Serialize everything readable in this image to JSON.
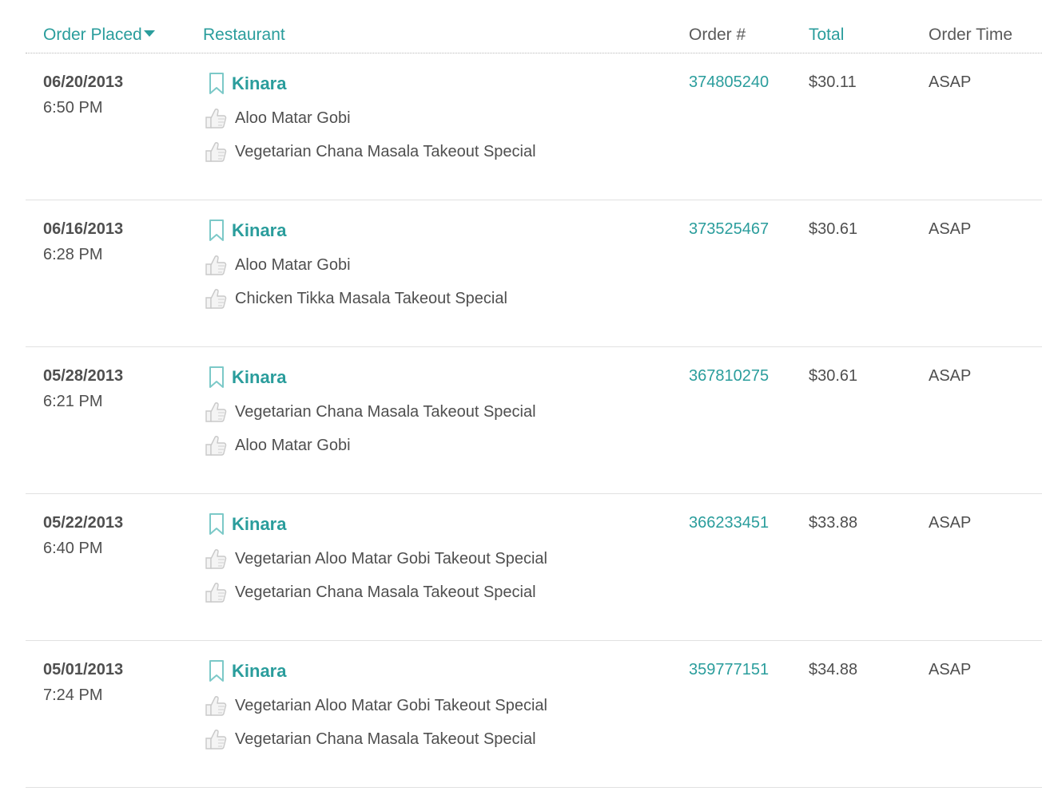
{
  "columns": {
    "order_placed": "Order Placed",
    "restaurant": "Restaurant",
    "order_number": "Order #",
    "total": "Total",
    "order_time": "Order Time"
  },
  "colors": {
    "accent": "#2a9d9c",
    "text": "#4f4f4f"
  },
  "icons": {
    "bookmark": "bookmark-icon",
    "item": "thumbs-up-icon",
    "sort": "sort-descending-arrow"
  },
  "orders": [
    {
      "date": "06/20/2013",
      "time": "6:50 PM",
      "restaurant": "Kinara",
      "items": [
        "Aloo Matar Gobi",
        "Vegetarian Chana Masala Takeout Special"
      ],
      "order_number": "374805240",
      "total": "$30.11",
      "order_time": "ASAP"
    },
    {
      "date": "06/16/2013",
      "time": "6:28 PM",
      "restaurant": "Kinara",
      "items": [
        "Aloo Matar Gobi",
        "Chicken Tikka Masala Takeout Special"
      ],
      "order_number": "373525467",
      "total": "$30.61",
      "order_time": "ASAP"
    },
    {
      "date": "05/28/2013",
      "time": "6:21 PM",
      "restaurant": "Kinara",
      "items": [
        "Vegetarian Chana Masala Takeout Special",
        "Aloo Matar Gobi"
      ],
      "order_number": "367810275",
      "total": "$30.61",
      "order_time": "ASAP"
    },
    {
      "date": "05/22/2013",
      "time": "6:40 PM",
      "restaurant": "Kinara",
      "items": [
        "Vegetarian Aloo Matar Gobi Takeout Special",
        "Vegetarian Chana Masala Takeout Special"
      ],
      "order_number": "366233451",
      "total": "$33.88",
      "order_time": "ASAP"
    },
    {
      "date": "05/01/2013",
      "time": "7:24 PM",
      "restaurant": "Kinara",
      "items": [
        "Vegetarian Aloo Matar Gobi Takeout Special",
        "Vegetarian Chana Masala Takeout Special"
      ],
      "order_number": "359777151",
      "total": "$34.88",
      "order_time": "ASAP"
    }
  ]
}
